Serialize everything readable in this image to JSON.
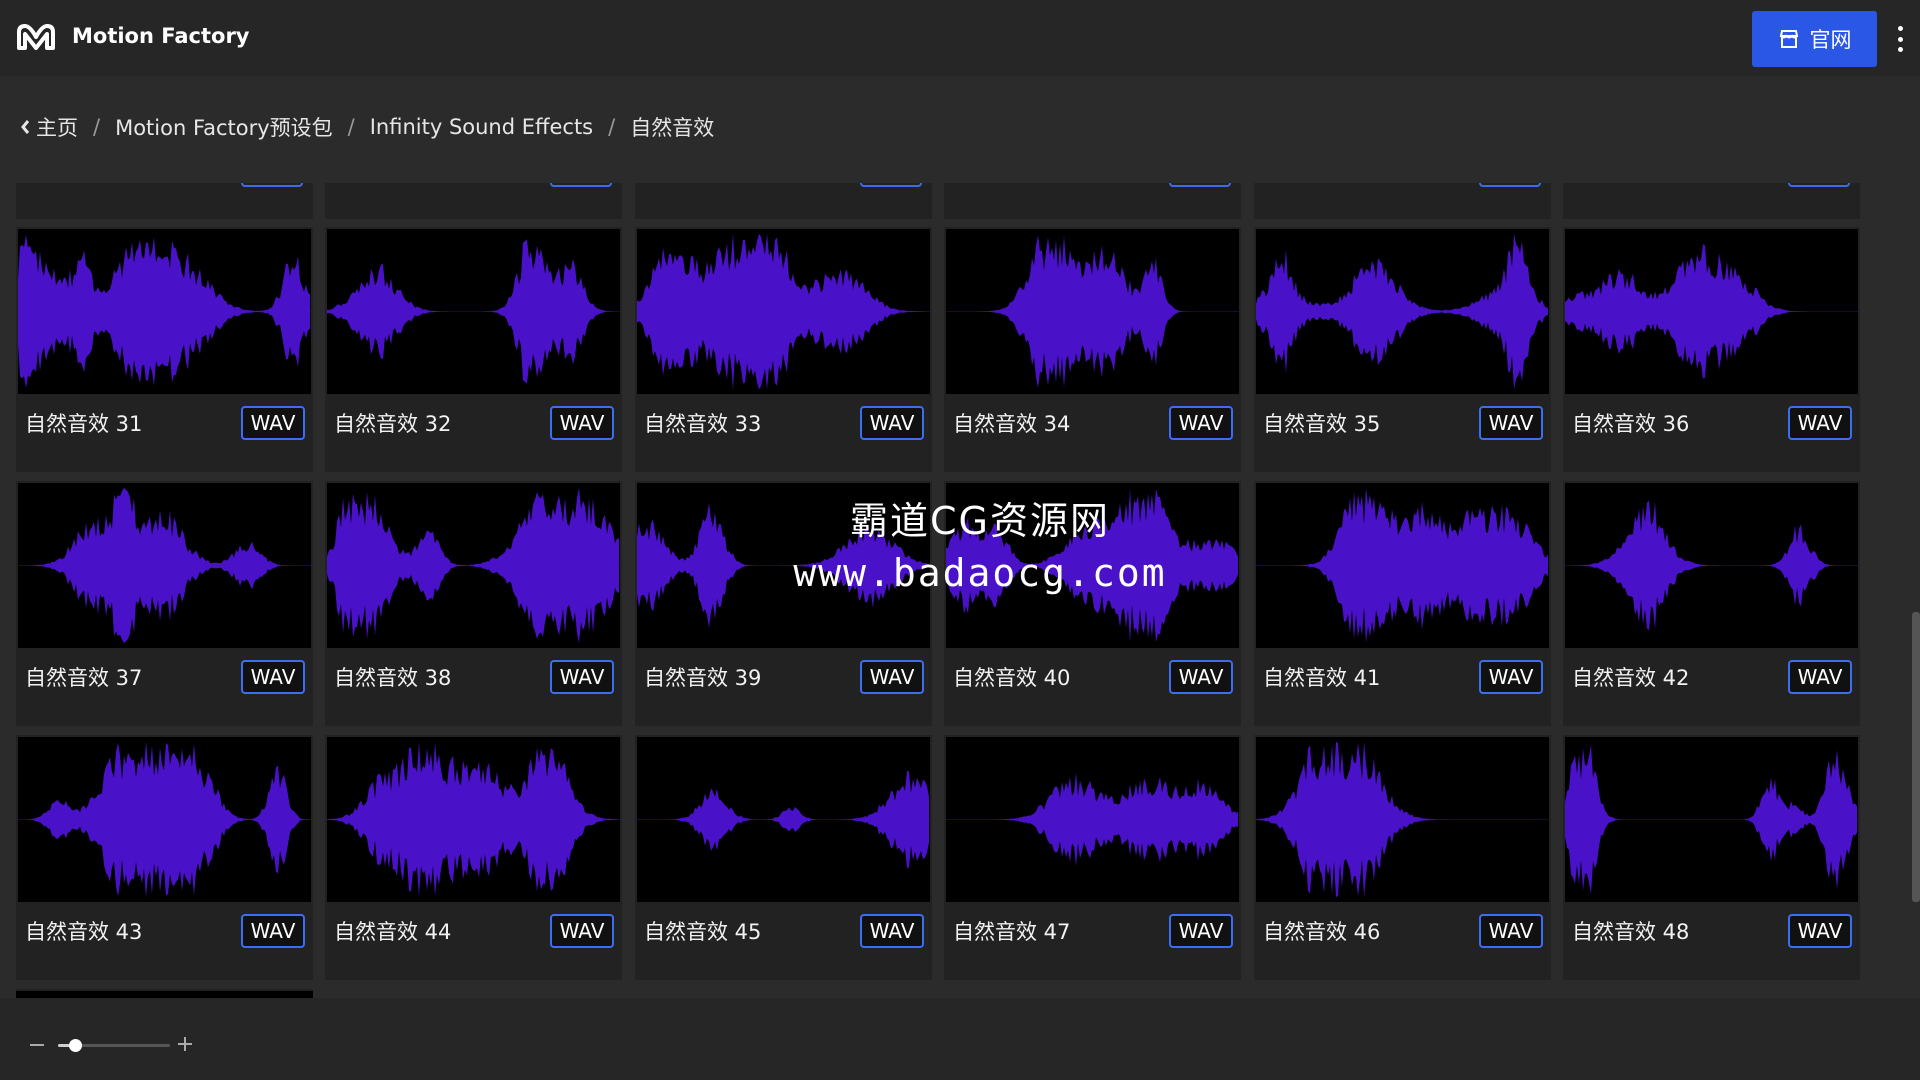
{
  "app": {
    "title": "Motion Factory",
    "logo_icon": "mf-logo-icon",
    "site_button_label": "官网",
    "site_button_icon": "store-icon",
    "more_icon": "vertical-ellipsis-icon",
    "accent_color": "#2a57e6"
  },
  "breadcrumb": {
    "back_icon": "chevron-left-icon",
    "items": [
      "主页",
      "Motion Factory预设包",
      "Infinity Sound Effects",
      "自然音效"
    ],
    "separator": "/"
  },
  "waveform_color": "#4a12c8",
  "cards": [
    {
      "title": "自然音效 31",
      "badge": "WAV"
    },
    {
      "title": "自然音效 32",
      "badge": "WAV"
    },
    {
      "title": "自然音效 33",
      "badge": "WAV"
    },
    {
      "title": "自然音效 34",
      "badge": "WAV"
    },
    {
      "title": "自然音效 35",
      "badge": "WAV"
    },
    {
      "title": "自然音效 36",
      "badge": "WAV"
    },
    {
      "title": "自然音效 37",
      "badge": "WAV"
    },
    {
      "title": "自然音效 38",
      "badge": "WAV"
    },
    {
      "title": "自然音效 39",
      "badge": "WAV"
    },
    {
      "title": "自然音效 40",
      "badge": "WAV"
    },
    {
      "title": "自然音效 41",
      "badge": "WAV"
    },
    {
      "title": "自然音效 42",
      "badge": "WAV"
    },
    {
      "title": "自然音效 43",
      "badge": "WAV"
    },
    {
      "title": "自然音效 44",
      "badge": "WAV"
    },
    {
      "title": "自然音效 45",
      "badge": "WAV"
    },
    {
      "title": "自然音效 47",
      "badge": "WAV"
    },
    {
      "title": "自然音效 46",
      "badge": "WAV"
    },
    {
      "title": "自然音效 48",
      "badge": "WAV"
    }
  ],
  "watermark": {
    "line1": "霸道CG资源网",
    "line2": "www.badaocg.com"
  },
  "zoom": {
    "minus_icon": "minus-icon",
    "plus_icon": "plus-icon",
    "level": 0.15
  }
}
